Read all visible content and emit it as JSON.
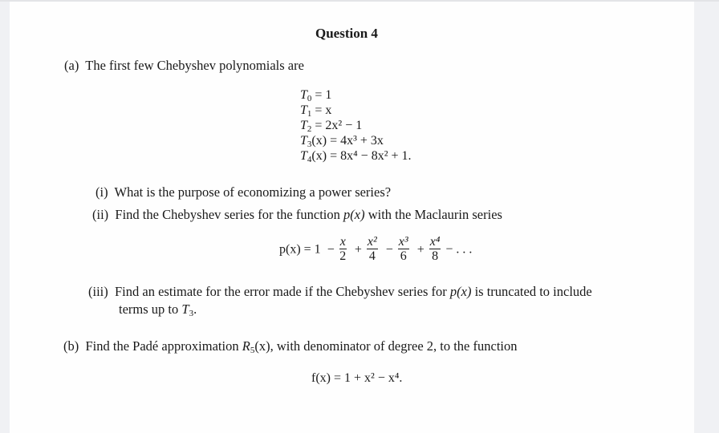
{
  "document": {
    "title": "Question 4",
    "part_a": {
      "label": "(a)",
      "intro": "The first few Chebyshev polynomials are",
      "polynomials": [
        {
          "lhs_base": "T",
          "lhs_sub": "0",
          "lhs_arg": "",
          "rhs": "= 1"
        },
        {
          "lhs_base": "T",
          "lhs_sub": "1",
          "lhs_arg": "",
          "rhs": "= x"
        },
        {
          "lhs_base": "T",
          "lhs_sub": "2",
          "lhs_arg": "",
          "rhs": "= 2x² − 1"
        },
        {
          "lhs_base": "T",
          "lhs_sub": "3",
          "lhs_arg": "(x)",
          "rhs": "= 4x³ + 3x"
        },
        {
          "lhs_base": "T",
          "lhs_sub": "4",
          "lhs_arg": "(x)",
          "rhs": "= 8x⁴ − 8x² + 1."
        }
      ],
      "subparts": [
        {
          "label": "(i)",
          "text": "What is the purpose of economizing a power series?"
        },
        {
          "label": "(ii)",
          "text_before": "Find the Chebyshev series for the function ",
          "func": "p(x)",
          "text_after": " with the Maclaurin series"
        },
        {
          "label": "(iii)",
          "text_before": "Find an estimate for the error made if the Chebyshev series for ",
          "func": "p(x)",
          "text_after": " is truncated to include",
          "line2_before": "terms up to ",
          "line2_sym": "T",
          "line2_sub": "3",
          "line2_after": "."
        }
      ],
      "maclaurin": {
        "lhs": "p(x) = 1",
        "terms": [
          {
            "sign": "−",
            "num": "x",
            "den": "2"
          },
          {
            "sign": "+",
            "num": "x²",
            "den": "4"
          },
          {
            "sign": "−",
            "num": "x³",
            "den": "6"
          },
          {
            "sign": "+",
            "num": "x⁴",
            "den": "8"
          }
        ],
        "tail": "− . . ."
      }
    },
    "part_b": {
      "label": "(b)",
      "text_before": "Find the Padé approximation ",
      "sym": "R",
      "sym_sub": "5",
      "sym_arg": "(x)",
      "text_after": ", with denominator of degree 2, to the function",
      "equation": "f(x) = 1 + x² − x⁴."
    }
  }
}
